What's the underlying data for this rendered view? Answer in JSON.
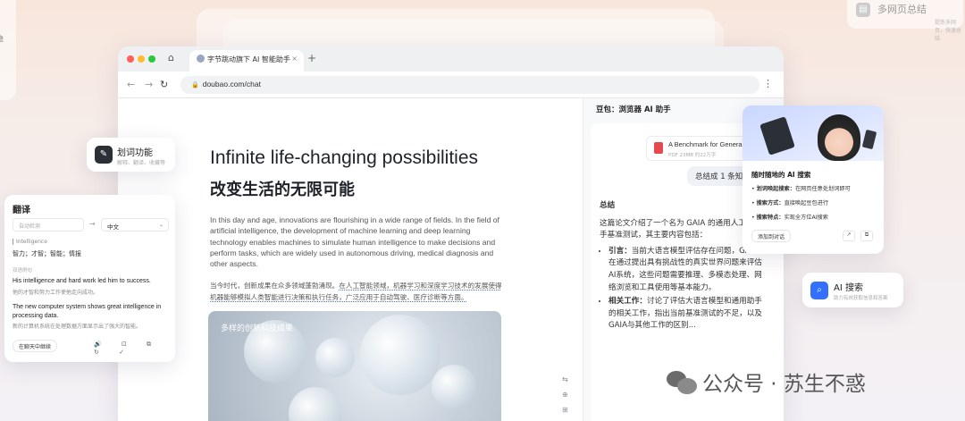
{
  "background": {
    "left_partial_text": "隐",
    "top_right_card": {
      "title": "多网页总结",
      "subtitle": "提炼多网页，快速总结"
    }
  },
  "browser": {
    "tab_title": "字节跳动旗下 AI 智能助手",
    "tab_close": "×",
    "new_tab": "+",
    "home": "⌂",
    "back": "←",
    "forward": "→",
    "reload": "↻",
    "lock": "🔒",
    "url": "doubao.com/chat",
    "menu": "⋮"
  },
  "page": {
    "hero_en": "Infinite life-changing possibilities",
    "hero_zh": "改变生活的无限可能",
    "para_en": "In this day and age, innovations are flourishing in a wide range of fields. In the field of artificial intelligence, the development of machine learning and deep learning technology enables machines to simulate human intelligence to make decisions and perform tasks, which are widely used in autonomous driving, medical diagnosis and other aspects.",
    "para_zh_1": "当今时代，创新成果在众多领域蓬勃涌现。",
    "para_zh_2": "在人工智能领域，机器学习和深度学习技术的发展使得机器能够模拟人类智能进行决策和执行任务，广泛应用于自动驾驶、医疗诊断等方面。",
    "image_label": "多样的创新科技成果",
    "side_tools": [
      "⇆",
      "⊕",
      "⊞",
      "⊡"
    ]
  },
  "panel": {
    "title": "豆包：浏览器 AI 助手",
    "file_name": "A Benchmark for General",
    "file_meta": "PDF 23MB 约22万字",
    "question": "总结成 1 条知识",
    "answer_heading": "总结",
    "answer_intro": "这篇论文介绍了一个名为 GAIA 的通用人工智能助手基准测试，其主要内容包括：",
    "bullets": [
      {
        "k": "引言：",
        "v": "当前大语言模型评估存在问题，GAIA 旨在通过提出具有挑战性的真实世界问题来评估AI系统，这些问题需要推理、多模态处理、网络浏览和工具使用等基本能力。"
      },
      {
        "k": "相关工作：",
        "v": "讨论了评估大语言模型和通用助手的相关工作，指出当前基准测试的不足，以及GAIA与其他工作的区别..."
      }
    ]
  },
  "cards": {
    "huaci": {
      "icon": "✎",
      "title": "划词功能",
      "subtitle": "解释、翻译、收藏等"
    },
    "translate": {
      "title": "翻译",
      "source_lang": "自动检测",
      "arrow": "→",
      "target_lang": "中文",
      "chevron": "⌄",
      "word": "Intelligence",
      "definition": "智力；才智；智能；情报",
      "examples_label": "双语例句",
      "ex1_en": "His intelligence and hard work led him to success.",
      "ex1_zh": "他的才智和努力工作使他走向成功。",
      "ex2_en": "The new computer system shows great intelligence in processing data.",
      "ex2_zh": "新的计算机系统在处理数据方面显示出了强大的智能。",
      "continue_chat": "在聊天中继续",
      "actions": "🔊 ⊡ ⧉ ↻ ✓"
    },
    "ai_search_panel": {
      "heading": "随时随地的 AI 搜索",
      "lines": [
        {
          "k": "划词唤起搜索：",
          "v": "在网页任意处划词即可"
        },
        {
          "k": "搜索方式：",
          "v": "直接唤起豆包进行"
        },
        {
          "k": "搜索特点：",
          "v": "实现全方位AI搜索"
        }
      ],
      "add_chat": "添加到对话",
      "icon_share": "↗",
      "icon_copy": "⧉"
    },
    "ai_search": {
      "icon": "⌕",
      "title": "AI 搜索",
      "subtitle": "助力有效获取信息和答案"
    }
  },
  "watermark": "公众号 · 苏生不惑"
}
